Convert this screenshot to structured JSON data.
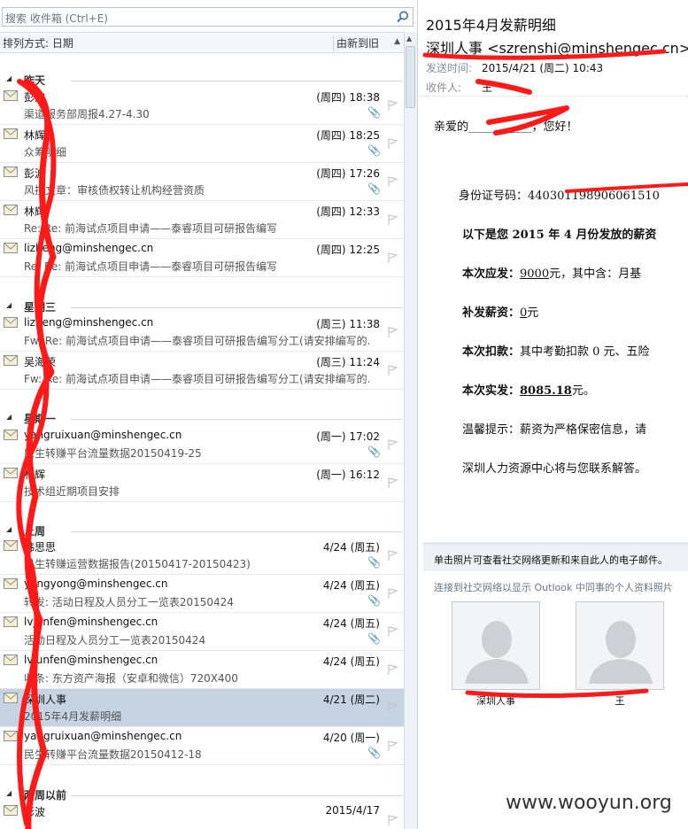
{
  "search": {
    "placeholder": "搜索 收件箱 (Ctrl+E)"
  },
  "sort": {
    "label": "排列方式: 日期",
    "order": "由新到旧"
  },
  "groups": {
    "yesterday": "昨天",
    "wednesday": "星期三",
    "monday": "星期一",
    "lastweek": "上周",
    "twoweeks": "两周以前"
  },
  "mails": [
    {
      "from": "彭波",
      "date": "(周四) 18:38",
      "subject": "渠道服务部周报4.27-4.30",
      "attach": true
    },
    {
      "from": "林辉",
      "date": "(周四) 18:25",
      "subject": "众筹明细",
      "attach": true
    },
    {
      "from": "彭波",
      "date": "(周四) 17:26",
      "subject": "风控文章：审核债权转让机构经营资质",
      "attach": true
    },
    {
      "from": "林辉",
      "date": "(周四) 12:33",
      "subject": "Re: Re: 前海试点项目申请——泰睿项目可研报告编写",
      "attach": false
    },
    {
      "from": "lizheng@minshengec.cn",
      "date": "(周四) 12:25",
      "subject": "Re: Re: 前海试点项目申请——泰睿项目可研报告编写",
      "attach": false
    },
    {
      "from": "lizheng@minshengec.cn",
      "date": "(周三) 11:38",
      "subject": "Fw: Re: 前海试点项目申请——泰睿项目可研报告编写分工(请安排编写的...",
      "attach": false
    },
    {
      "from": "吴海荣",
      "date": "(周三) 11:24",
      "subject": "Fw: Re: 前海试点项目申请——泰睿项目可研报告编写分工(请安排编写的...",
      "attach": false
    },
    {
      "from": "yangruixuan@minshengec.cn",
      "date": "(周一) 17:02",
      "subject": "民生转赚平台流量数据20150419-25",
      "attach": true
    },
    {
      "from": "林辉",
      "date": "(周一) 16:12",
      "subject": "技术组近期项目安排",
      "attach": false
    },
    {
      "from": "韩思思",
      "date": "4/24 (周五)",
      "subject": "民生转赚运营数据报告(20150417-20150423)",
      "attach": true
    },
    {
      "from": "yangyong@minshengec.cn",
      "date": "4/24 (周五)",
      "subject": "转发: 活动日程及人员分工一览表20150424",
      "attach": true
    },
    {
      "from": "lvjunfen@minshengec.cn",
      "date": "4/24 (周五)",
      "subject": "活动日程及人员分工一览表20150424",
      "attach": true
    },
    {
      "from": "lvjunfen@minshengec.cn",
      "date": "4/24 (周五)",
      "subject": "收条: 东方资产海报（安卓和微信）720X400",
      "attach": false
    },
    {
      "from": "深圳人事",
      "date": "4/21 (周二)",
      "subject": "2015年4月发薪明细",
      "attach": false
    },
    {
      "from": "yangruixuan@minshengec.cn",
      "date": "4/20 (周一)",
      "subject": "民生转赚平台流量数据20150412-18",
      "attach": true
    },
    {
      "from": "彭波",
      "date": "2015/4/17",
      "subject": "",
      "attach": false
    }
  ],
  "reading": {
    "subject": "2015年4月发薪明细",
    "sender": "深圳人事 <szrenshi@minshengec.cn>",
    "sent_label": "发送时间:",
    "sent_value": "2015/4/21 (周二) 10:43",
    "to_label": "收件人:",
    "to_value": "王",
    "greeting": "亲爱的___________，您好！",
    "id_label": "身份证号码：",
    "id_value": "440301198906061510",
    "line1": "以下是您 2015 年 4 月份发放的薪资",
    "line2_label": "本次应发：",
    "line2_value": "9000",
    "line2_rest": "元，其中含：月基",
    "line3_label": "补发薪资：",
    "line3_value": "0",
    "line3_rest": "元",
    "line4_label": "本次扣款：",
    "line4_rest": "其中考勤扣款 0 元、五险",
    "line5_label": "本次实发：",
    "line5_value": "8085.18",
    "line5_rest": "元。",
    "tip": "温馨提示：薪资为严格保密信息，请",
    "tip2": "深圳人力资源中心将与您联系解答。"
  },
  "social": {
    "title": "单击照片可查看社交网络更新和来自此人的电子邮件。",
    "link": "连接到社交网络以显示 Outlook 中同事的个人资料照片",
    "person1": "深圳人事",
    "person2": "王"
  },
  "watermark": "www.wooyun.org",
  "colors": {
    "selection": "#c5d3e3",
    "scribble": "#ff1a1a"
  }
}
